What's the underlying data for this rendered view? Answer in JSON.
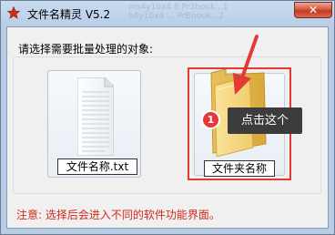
{
  "window": {
    "title": "文件名精灵 V5.2",
    "title_icon": "red-star-icon",
    "close_label": "✕",
    "background_ghost_text": [
      "ms4y10x4 8  Pr3bouk...1",
      "b4y10x4 ...  PrBbouk...2"
    ]
  },
  "main": {
    "prompt": "请选择需要批量处理的对象:",
    "options": [
      {
        "label": "文件名称.txt",
        "icon": "text-document-icon"
      },
      {
        "label": "文件夹名称",
        "icon": "folder-icon"
      }
    ],
    "note": "注意: 选择后会进入不同的软件功能界面。"
  },
  "annotation": {
    "step": "1",
    "callout": "点击这个",
    "highlight_color": "#e53935",
    "arrow_color": "#e53935"
  }
}
